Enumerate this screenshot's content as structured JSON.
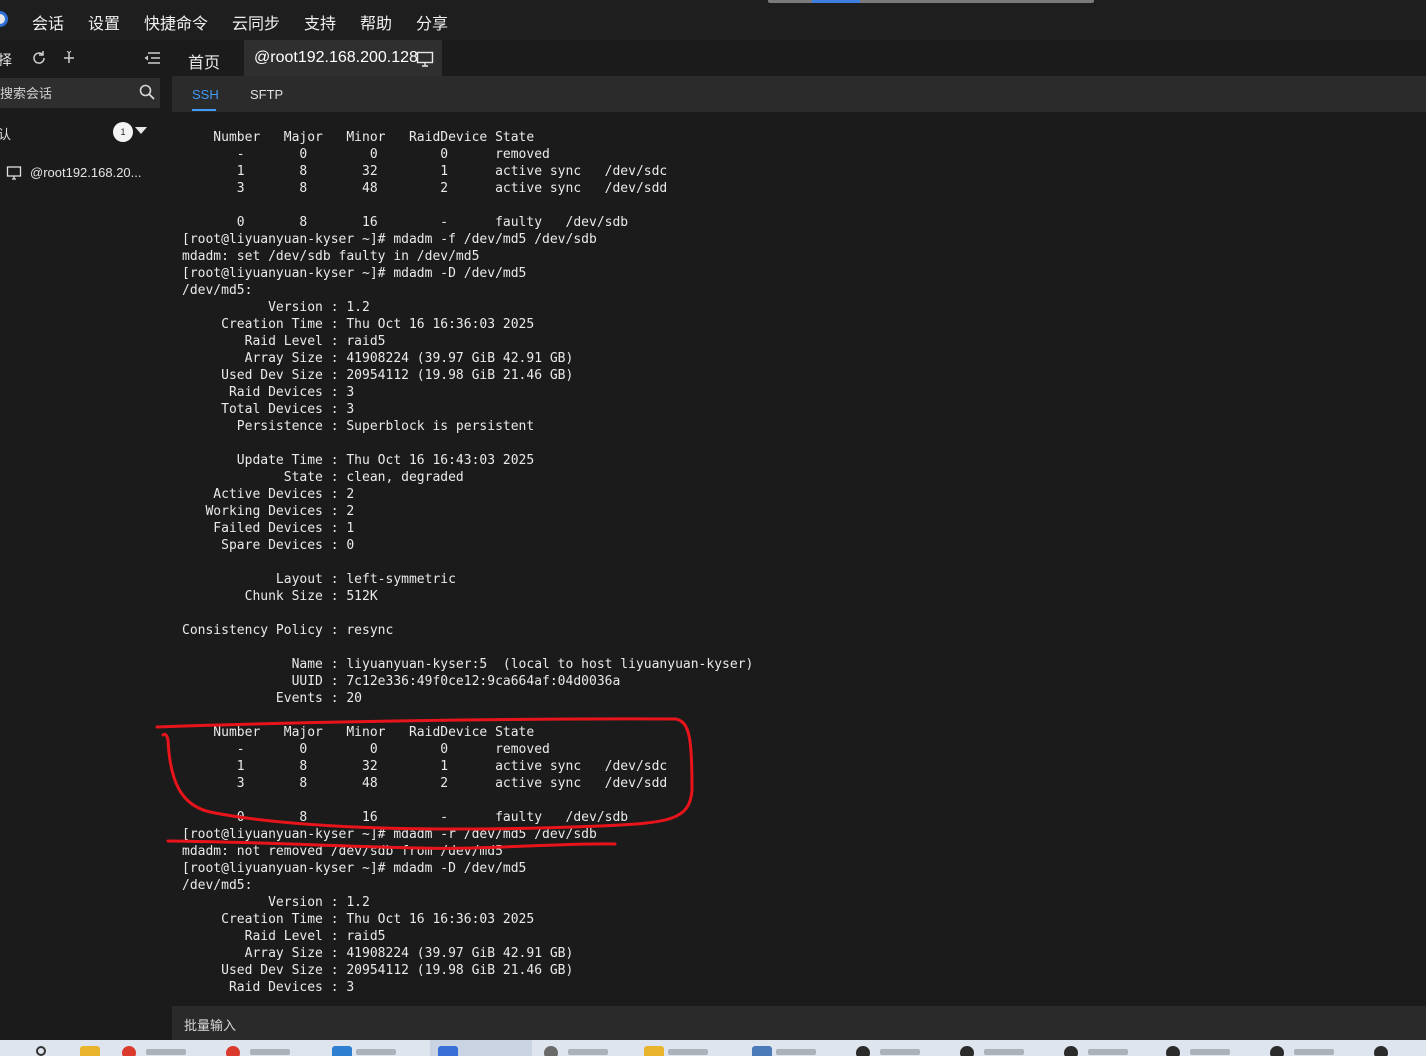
{
  "menu": {
    "items": [
      "会话",
      "设置",
      "快捷命令",
      "云同步",
      "支持",
      "帮助",
      "分享"
    ]
  },
  "sidebar": {
    "toolbar_label": "择",
    "search_placeholder": "搜索会话",
    "group_label": "认",
    "group_badge": "1",
    "session_label": "@root192.168.20..."
  },
  "tabs": {
    "home": "首页",
    "active": "@root192.168.200.128"
  },
  "subtabs": {
    "ssh": "SSH",
    "sftp": "SFTP"
  },
  "terminal": {
    "lines": [
      "    Number   Major   Minor   RaidDevice State",
      "       -       0        0        0      removed",
      "       1       8       32        1      active sync   /dev/sdc",
      "       3       8       48        2      active sync   /dev/sdd",
      "",
      "       0       8       16        -      faulty   /dev/sdb",
      "[root@liyuanyuan-kyser ~]# mdadm -f /dev/md5 /dev/sdb",
      "mdadm: set /dev/sdb faulty in /dev/md5",
      "[root@liyuanyuan-kyser ~]# mdadm -D /dev/md5",
      "/dev/md5:",
      "           Version : 1.2",
      "     Creation Time : Thu Oct 16 16:36:03 2025",
      "        Raid Level : raid5",
      "        Array Size : 41908224 (39.97 GiB 42.91 GB)",
      "     Used Dev Size : 20954112 (19.98 GiB 21.46 GB)",
      "      Raid Devices : 3",
      "     Total Devices : 3",
      "       Persistence : Superblock is persistent",
      "",
      "       Update Time : Thu Oct 16 16:43:03 2025",
      "             State : clean, degraded",
      "    Active Devices : 2",
      "   Working Devices : 2",
      "    Failed Devices : 1",
      "     Spare Devices : 0",
      "",
      "            Layout : left-symmetric",
      "        Chunk Size : 512K",
      "",
      "Consistency Policy : resync",
      "",
      "              Name : liyuanyuan-kyser:5  (local to host liyuanyuan-kyser)",
      "              UUID : 7c12e336:49f0ce12:9ca664af:04d0036a",
      "            Events : 20",
      "",
      "    Number   Major   Minor   RaidDevice State",
      "       -       0        0        0      removed",
      "       1       8       32        1      active sync   /dev/sdc",
      "       3       8       48        2      active sync   /dev/sdd",
      "",
      "       0       8       16        -      faulty   /dev/sdb",
      "[root@liyuanyuan-kyser ~]# mdadm -r /dev/md5 /dev/sdb",
      "mdadm: not removed /dev/sdb from /dev/md5",
      "[root@liyuanyuan-kyser ~]# mdadm -D /dev/md5",
      "/dev/md5:",
      "           Version : 1.2",
      "     Creation Time : Thu Oct 16 16:36:03 2025",
      "        Raid Level : raid5",
      "        Array Size : 41908224 (39.97 GiB 42.91 GB)",
      "     Used Dev Size : 20954112 (19.98 GiB 21.46 GB)",
      "      Raid Devices : 3"
    ]
  },
  "batch_input": {
    "label": "批量输入"
  },
  "colors": {
    "accent": "#3f9bf5",
    "annotation": "#e8141c",
    "terminal_bg": "#1b1b1b",
    "terminal_fg": "#eaeaea"
  }
}
